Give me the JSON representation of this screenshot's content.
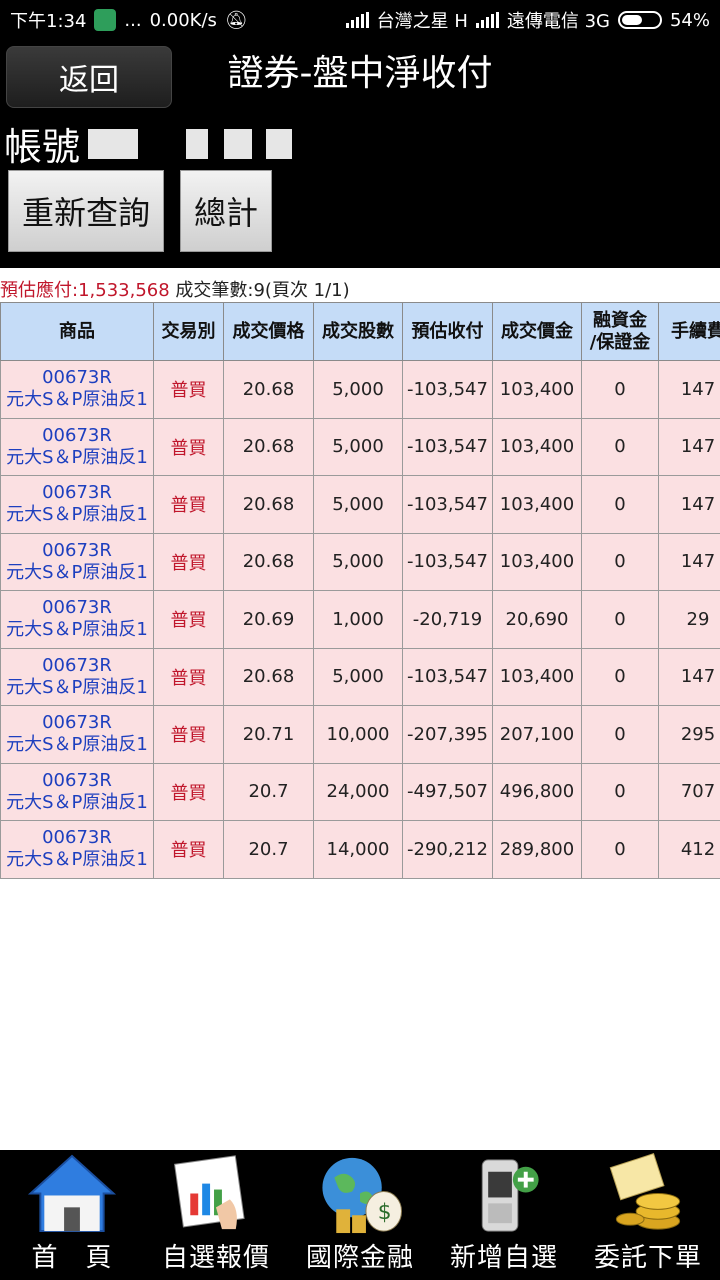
{
  "status_bar": {
    "time": "下午1:34",
    "dots": "...",
    "speed": "0.00K/s",
    "carrier1": "台灣之星 H",
    "carrier2": "遠傳電信 3G",
    "battery": "54%"
  },
  "header": {
    "back_label": "返回",
    "title": "證券-盤中淨收付",
    "account_label": "帳號",
    "requery_label": "重新查詢",
    "total_label": "總計"
  },
  "summary": {
    "payable_label": "預估應付:1,533,568",
    "count_label": " 成交筆數:9(頁次 1/1)"
  },
  "table": {
    "headers": [
      "商品",
      "交易別",
      "成交價格",
      "成交股數",
      "預估收付",
      "成交價金",
      "融資金\n/保證金",
      "手續費"
    ],
    "rows": [
      {
        "code": "00673R",
        "name": "元大S＆P原油反1",
        "side": "普買",
        "price": "20.68",
        "shares": "5,000",
        "net": "-103,547",
        "amount": "103,400",
        "margin": "0",
        "fee": "147"
      },
      {
        "code": "00673R",
        "name": "元大S＆P原油反1",
        "side": "普買",
        "price": "20.68",
        "shares": "5,000",
        "net": "-103,547",
        "amount": "103,400",
        "margin": "0",
        "fee": "147"
      },
      {
        "code": "00673R",
        "name": "元大S＆P原油反1",
        "side": "普買",
        "price": "20.68",
        "shares": "5,000",
        "net": "-103,547",
        "amount": "103,400",
        "margin": "0",
        "fee": "147"
      },
      {
        "code": "00673R",
        "name": "元大S＆P原油反1",
        "side": "普買",
        "price": "20.68",
        "shares": "5,000",
        "net": "-103,547",
        "amount": "103,400",
        "margin": "0",
        "fee": "147"
      },
      {
        "code": "00673R",
        "name": "元大S＆P原油反1",
        "side": "普買",
        "price": "20.69",
        "shares": "1,000",
        "net": "-20,719",
        "amount": "20,690",
        "margin": "0",
        "fee": "29"
      },
      {
        "code": "00673R",
        "name": "元大S＆P原油反1",
        "side": "普買",
        "price": "20.68",
        "shares": "5,000",
        "net": "-103,547",
        "amount": "103,400",
        "margin": "0",
        "fee": "147"
      },
      {
        "code": "00673R",
        "name": "元大S＆P原油反1",
        "side": "普買",
        "price": "20.71",
        "shares": "10,000",
        "net": "-207,395",
        "amount": "207,100",
        "margin": "0",
        "fee": "295"
      },
      {
        "code": "00673R",
        "name": "元大S＆P原油反1",
        "side": "普買",
        "price": "20.7",
        "shares": "24,000",
        "net": "-497,507",
        "amount": "496,800",
        "margin": "0",
        "fee": "707"
      },
      {
        "code": "00673R",
        "name": "元大S＆P原油反1",
        "side": "普買",
        "price": "20.7",
        "shares": "14,000",
        "net": "-290,212",
        "amount": "289,800",
        "margin": "0",
        "fee": "412"
      }
    ]
  },
  "bottom_nav": [
    {
      "label": "首　頁",
      "icon": "home-icon"
    },
    {
      "label": "自選報價",
      "icon": "chart-icon"
    },
    {
      "label": "國際金融",
      "icon": "globe-money-icon"
    },
    {
      "label": "新增自選",
      "icon": "phone-add-icon"
    },
    {
      "label": "委託下單",
      "icon": "coins-icon"
    }
  ],
  "colors": {
    "header_bg": "#000000",
    "table_header_bg": "#c5dcf7",
    "row_bg": "#fbe0e2",
    "product_text": "#1d3fbf",
    "buy_text": "#c0162b"
  }
}
